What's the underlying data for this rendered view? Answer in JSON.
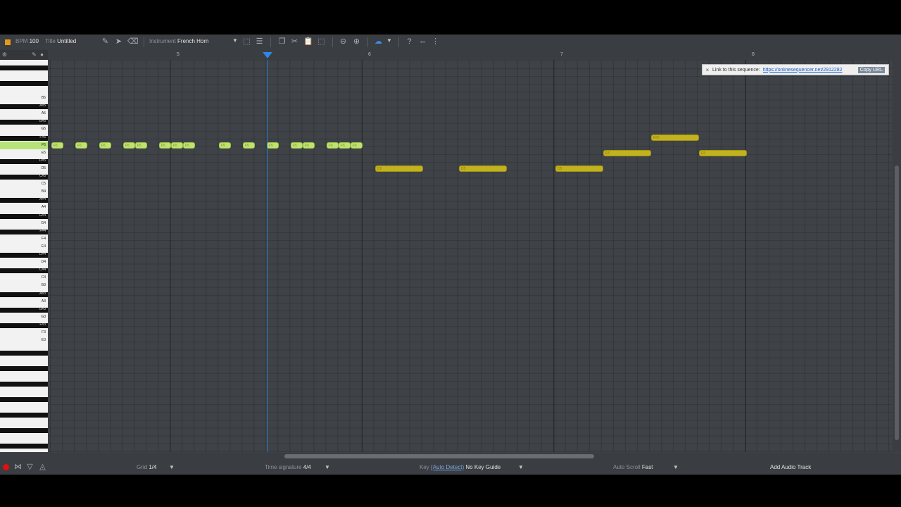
{
  "toolbar": {
    "bpm_label": "BPM",
    "bpm_value": "100",
    "title_label": "Title",
    "title_value": "Untitled",
    "instrument_label": "Instrument",
    "instrument_value": "French Horn"
  },
  "ruler": {
    "measures": [
      "5",
      "6",
      "7",
      "8"
    ]
  },
  "link_box": {
    "text": "Link to this sequence:",
    "url": "https://onlinesequencer.net/2912282",
    "copy_label": "Copy URL"
  },
  "piano_labels": [
    "B5",
    "A#5",
    "A5",
    "G#5",
    "G5",
    "F#5",
    "F5",
    "E5",
    "D#5",
    "D5",
    "C#5",
    "C5",
    "B4",
    "A#4",
    "A4",
    "G#4",
    "G4",
    "F#4",
    "F4",
    "E4",
    "D#4",
    "D4",
    "C#4",
    "C4",
    "B3",
    "A#3",
    "A3",
    "G#3",
    "G3",
    "F#3",
    "F3",
    "E3"
  ],
  "notes": [
    {
      "label": "F5",
      "color": "green"
    },
    {
      "label": "F5",
      "color": "green"
    },
    {
      "label": "F5",
      "color": "green"
    },
    {
      "label": "F5",
      "color": "green"
    },
    {
      "label": "F5",
      "color": "green"
    },
    {
      "label": "F5",
      "color": "green"
    },
    {
      "label": "F5",
      "color": "green"
    },
    {
      "label": "F5",
      "color": "green"
    },
    {
      "label": "F5",
      "color": "green"
    },
    {
      "label": "F5",
      "color": "green"
    },
    {
      "label": "F5",
      "color": "green"
    },
    {
      "label": "F5",
      "color": "green"
    },
    {
      "label": "F5",
      "color": "green"
    },
    {
      "label": "F5",
      "color": "green"
    },
    {
      "label": "F5",
      "color": "green"
    },
    {
      "label": "F5",
      "color": "green"
    },
    {
      "label": "F5",
      "color": "green"
    },
    {
      "label": "F5",
      "color": "green"
    },
    {
      "label": "D5",
      "color": "olive"
    },
    {
      "label": "D5",
      "color": "olive"
    },
    {
      "label": "D5",
      "color": "olive"
    },
    {
      "label": "E5",
      "color": "olive"
    },
    {
      "label": "F#5",
      "color": "olive"
    },
    {
      "label": "E5",
      "color": "olive"
    }
  ],
  "bottom": {
    "grid_label": "Grid",
    "grid_value": "1/4",
    "timesig_label": "Time signature",
    "timesig_value": "4/4",
    "key_label": "Key",
    "key_detect": "(Auto Detect)",
    "key_value": "No Key Guide",
    "autoscroll_label": "Auto Scroll",
    "autoscroll_value": "Fast",
    "add_audio_label": "Add Audio Track"
  },
  "colors": {
    "note_green": "#bfe36e",
    "note_olive": "#c2b21e",
    "playhead": "#2f86e6",
    "record": "#dd1111"
  }
}
